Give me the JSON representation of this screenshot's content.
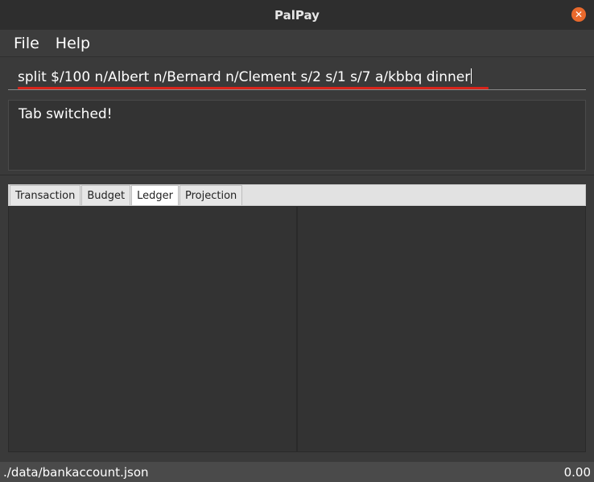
{
  "window": {
    "title": "PalPay"
  },
  "menu": {
    "items": [
      {
        "label": "File"
      },
      {
        "label": "Help"
      }
    ]
  },
  "command": {
    "value": "split $/100 n/Albert n/Bernard n/Clement s/2 s/1 s/7 a/kbbq dinner"
  },
  "result": {
    "message": "Tab switched!"
  },
  "tabs": [
    {
      "label": "Transaction",
      "active": false
    },
    {
      "label": "Budget",
      "active": false
    },
    {
      "label": "Ledger",
      "active": true
    },
    {
      "label": "Projection",
      "active": false
    }
  ],
  "status": {
    "file_path": "./data/bankaccount.json",
    "balance": "0.00"
  },
  "colors": {
    "close_button": "#e9692c",
    "error_underline": "#d9231a"
  },
  "icons": {
    "close": "close-icon"
  }
}
